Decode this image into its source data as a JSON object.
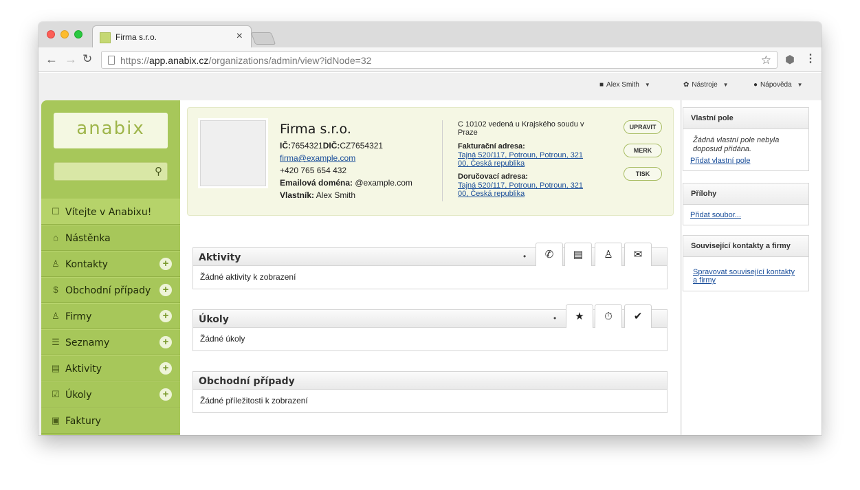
{
  "browser": {
    "tab_title": "Firma s.r.o.",
    "tab_close": "×",
    "url_scheme": "https://",
    "url_host": "app.anabix.cz",
    "url_path": "/organizations/admin/view?idNode=32"
  },
  "topnav": {
    "user": "Alex Smith",
    "tools": "Nástroje",
    "help": "Nápověda"
  },
  "sidebar": {
    "logo": "anabix",
    "search_placeholder": "",
    "items": [
      {
        "label": "Vítejte v Anabixu!",
        "icon": "chat-icon",
        "has_add": false
      },
      {
        "label": "Nástěnka",
        "icon": "home-icon",
        "has_add": false
      },
      {
        "label": "Kontakty",
        "icon": "person-icon",
        "has_add": true
      },
      {
        "label": "Obchodní případy",
        "icon": "dollar-icon",
        "has_add": true
      },
      {
        "label": "Firmy",
        "icon": "group-icon",
        "has_add": true
      },
      {
        "label": "Seznamy",
        "icon": "list-icon",
        "has_add": true
      },
      {
        "label": "Aktivity",
        "icon": "clipboard-icon",
        "has_add": true
      },
      {
        "label": "Úkoly",
        "icon": "task-icon",
        "has_add": true
      },
      {
        "label": "Faktury",
        "icon": "invoice-icon",
        "has_add": false
      }
    ]
  },
  "org": {
    "name": "Firma s.r.o.",
    "ic_label": "IČ:",
    "ic_value": "7654321",
    "dic_label": "DIČ:",
    "dic_value": "CZ7654321",
    "email": "firma@example.com",
    "phone": "+420 765 654 432",
    "domain_label": "Emailová doména:",
    "domain_value": "@example.com",
    "owner_label": "Vlastník:",
    "owner_value": "Alex Smith",
    "registration": "C 10102 vedená u Krajského soudu v Praze",
    "billing_label": "Fakturační adresa:",
    "billing_address": "Tajná 520/117, Potroun, Potroun, 321 00, Česká republika",
    "delivery_label": "Doručovací adresa:",
    "delivery_address": "Tajná 520/117, Potroun, Potroun, 321 00, Česká republika",
    "buttons": {
      "edit": "UPRAVIT",
      "merk": "MERK",
      "print": "TISK"
    }
  },
  "panels": {
    "activities": {
      "title": "Aktivity",
      "empty": "Žádné aktivity k zobrazení"
    },
    "tasks": {
      "title": "Úkoly",
      "empty": "Žádné úkoly"
    },
    "deals": {
      "title": "Obchodní případy",
      "empty": "Žádné příležitosti k zobrazení"
    }
  },
  "right": {
    "custom_fields": {
      "title": "Vlastní pole",
      "note": "Žádná vlastní pole nebyla doposud přidána.",
      "link": "Přidat vlastní pole"
    },
    "attachments": {
      "title": "Přílohy",
      "link": "Přidat soubor..."
    },
    "related": {
      "title": "Související kontakty a firmy",
      "link": "Spravovat související kontakty a firmy"
    }
  },
  "colors": {
    "sidebar": "#a7c75a",
    "card": "#f5f7e4",
    "link": "#1a4e9a"
  }
}
